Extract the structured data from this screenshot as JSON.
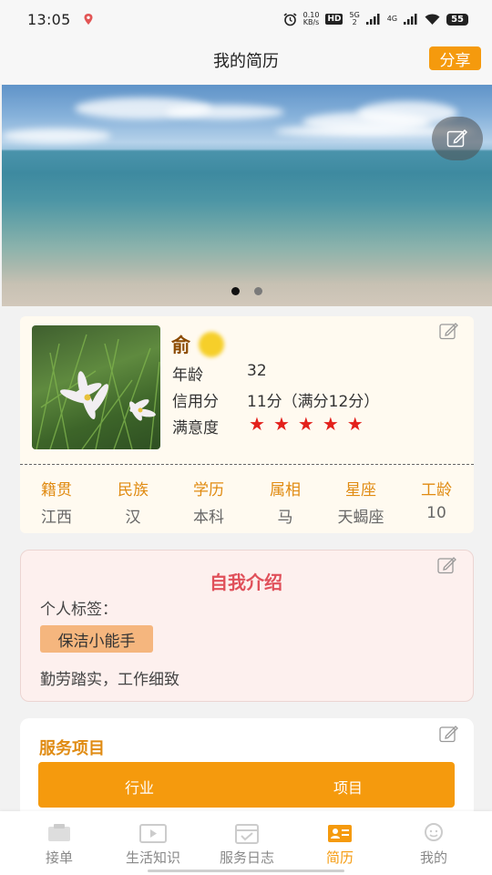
{
  "status_bar": {
    "time": "13:05",
    "net_speed_value": "0.10",
    "net_speed_unit": "KB/s",
    "hd_label": "HD",
    "sim_index": "2",
    "signal_5g": "5G",
    "signal_4g": "4G",
    "battery": "55",
    "icons": [
      "location-icon",
      "alarm-icon",
      "signal-icon",
      "wifi-icon",
      "battery-icon"
    ]
  },
  "nav": {
    "title": "我的简历",
    "share_label": "分享"
  },
  "banner": {
    "dots": 2,
    "active_dot": 0
  },
  "profile": {
    "name": "俞",
    "age_label": "年龄",
    "age_value": "32",
    "credit_label": "信用分",
    "credit_value": "11分（满分12分）",
    "satisfaction_label": "满意度",
    "satisfaction_stars": 5,
    "star_color": "#e3201b",
    "attributes": [
      {
        "label": "籍贯",
        "value": "江西"
      },
      {
        "label": "民族",
        "value": "汉"
      },
      {
        "label": "学历",
        "value": "本科"
      },
      {
        "label": "属相",
        "value": "马"
      },
      {
        "label": "星座",
        "value": "天蝎座"
      },
      {
        "label": "工龄",
        "value": "10"
      }
    ]
  },
  "intro": {
    "title": "自我介绍",
    "tags_label": "个人标签：",
    "tags": [
      "保洁小能手"
    ],
    "text": "勤劳踏实，工作细致"
  },
  "service": {
    "title": "服务项目",
    "tabs": [
      "行业",
      "项目"
    ]
  },
  "tabbar": {
    "items": [
      {
        "label": "接单",
        "icon": "orders-icon"
      },
      {
        "label": "生活知识",
        "icon": "video-icon"
      },
      {
        "label": "服务日志",
        "icon": "calendar-icon"
      },
      {
        "label": "简历",
        "icon": "resume-icon"
      },
      {
        "label": "我的",
        "icon": "profile-icon"
      }
    ],
    "active_index": 3
  },
  "colors": {
    "accent": "#f59a0d",
    "attr_label": "#e08b12",
    "intro_title": "#e0505a",
    "profile_bg": "#fffaf0",
    "intro_bg": "#fdf0ee"
  }
}
